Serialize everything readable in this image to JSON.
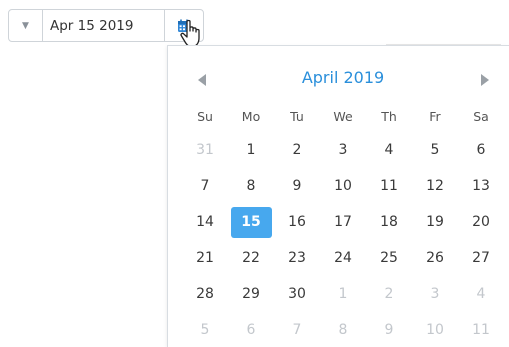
{
  "picker": {
    "value": "Apr 15 2019",
    "dropdown_icon": "caret-down-icon",
    "calendar_icon": "calendar-icon",
    "cursor_icon": "hand-pointer-icon"
  },
  "calendar": {
    "month_label": "April 2019",
    "prev_icon": "chevron-left-icon",
    "next_icon": "chevron-right-icon",
    "weekdays": [
      "Su",
      "Mo",
      "Tu",
      "We",
      "Th",
      "Fr",
      "Sa"
    ],
    "weeks": [
      [
        "31",
        "1",
        "2",
        "3",
        "4",
        "5",
        "6"
      ],
      [
        "7",
        "8",
        "9",
        "10",
        "11",
        "12",
        "13"
      ],
      [
        "14",
        "15",
        "16",
        "17",
        "18",
        "19",
        "20"
      ],
      [
        "21",
        "22",
        "23",
        "24",
        "25",
        "26",
        "27"
      ],
      [
        "28",
        "29",
        "30",
        "1",
        "2",
        "3",
        "4"
      ],
      [
        "5",
        "6",
        "7",
        "8",
        "9",
        "10",
        "11"
      ]
    ],
    "selected_day": "15",
    "colors": {
      "accent": "#47a8ee",
      "title": "#2a8fdb",
      "muted": "#c3c7cc"
    }
  }
}
